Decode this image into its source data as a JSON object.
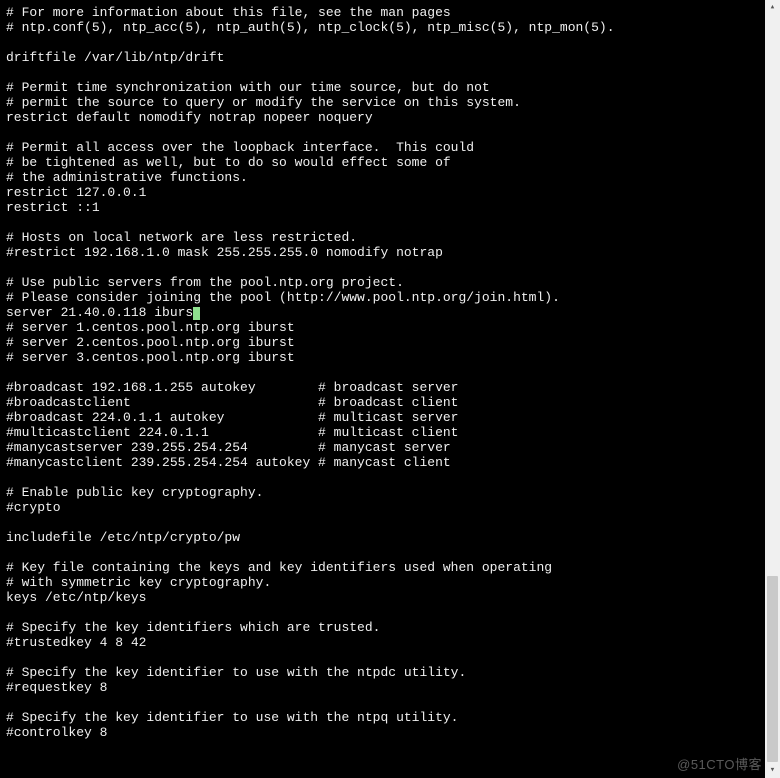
{
  "file": {
    "lines_before_cursor": [
      "# For more information about this file, see the man pages",
      "# ntp.conf(5), ntp_acc(5), ntp_auth(5), ntp_clock(5), ntp_misc(5), ntp_mon(5).",
      "",
      "driftfile /var/lib/ntp/drift",
      "",
      "# Permit time synchronization with our time source, but do not",
      "# permit the source to query or modify the service on this system.",
      "restrict default nomodify notrap nopeer noquery",
      "",
      "# Permit all access over the loopback interface.  This could",
      "# be tightened as well, but to do so would effect some of",
      "# the administrative functions.",
      "restrict 127.0.0.1",
      "restrict ::1",
      "",
      "# Hosts on local network are less restricted.",
      "#restrict 192.168.1.0 mask 255.255.255.0 nomodify notrap",
      "",
      "# Use public servers from the pool.ntp.org project.",
      "# Please consider joining the pool (http://www.pool.ntp.org/join.html)."
    ],
    "cursor_line_prefix": "server 21.40.0.118 iburs",
    "cursor_line_under": "t",
    "lines_after_cursor": [
      "# server 1.centos.pool.ntp.org iburst",
      "# server 2.centos.pool.ntp.org iburst",
      "# server 3.centos.pool.ntp.org iburst",
      "",
      "#broadcast 192.168.1.255 autokey        # broadcast server",
      "#broadcastclient                        # broadcast client",
      "#broadcast 224.0.1.1 autokey            # multicast server",
      "#multicastclient 224.0.1.1              # multicast client",
      "#manycastserver 239.255.254.254         # manycast server",
      "#manycastclient 239.255.254.254 autokey # manycast client",
      "",
      "# Enable public key cryptography.",
      "#crypto",
      "",
      "includefile /etc/ntp/crypto/pw",
      "",
      "# Key file containing the keys and key identifiers used when operating",
      "# with symmetric key cryptography.",
      "keys /etc/ntp/keys",
      "",
      "# Specify the key identifiers which are trusted.",
      "#trustedkey 4 8 42",
      "",
      "# Specify the key identifier to use with the ntpdc utility.",
      "#requestkey 8",
      "",
      "# Specify the key identifier to use with the ntpq utility.",
      "#controlkey 8"
    ]
  },
  "scrollbar": {
    "up_glyph": "▴",
    "down_glyph": "▾"
  },
  "watermark": "@51CTO博客"
}
